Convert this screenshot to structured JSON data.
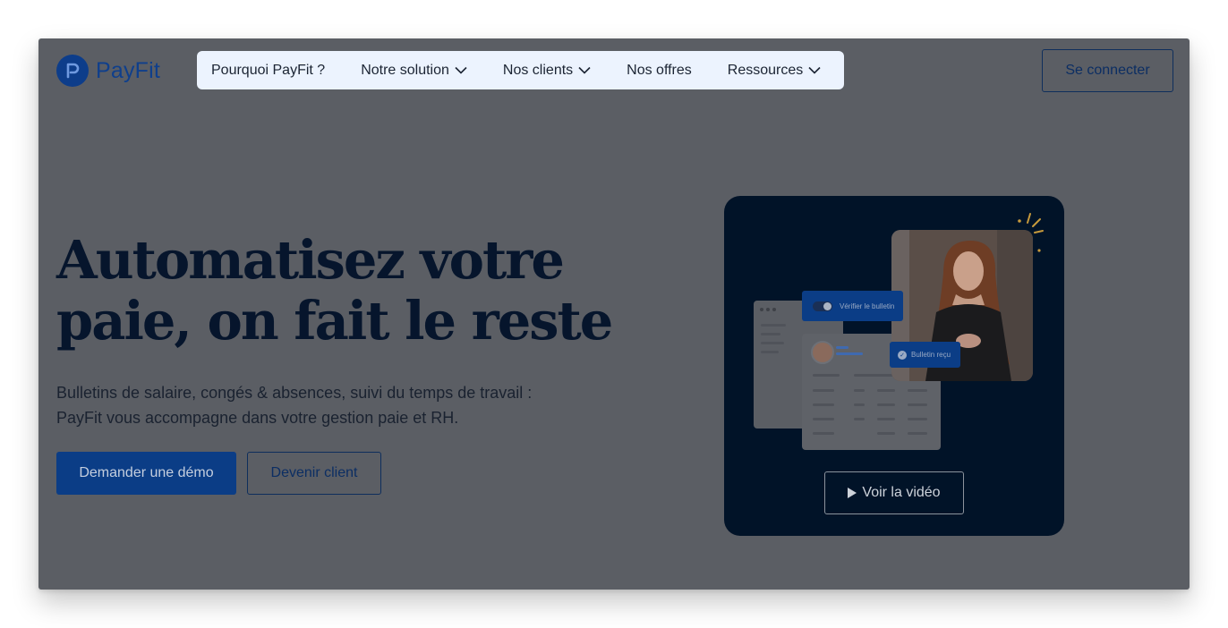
{
  "brand": {
    "name": "PayFit",
    "accent": "#0b3d86"
  },
  "nav": {
    "items": [
      {
        "label": "Pourquoi PayFit ?",
        "has_dropdown": false
      },
      {
        "label": "Notre solution",
        "has_dropdown": true
      },
      {
        "label": "Nos clients",
        "has_dropdown": true
      },
      {
        "label": "Nos offres",
        "has_dropdown": false
      },
      {
        "label": "Ressources",
        "has_dropdown": true
      }
    ],
    "login_label": "Se connecter"
  },
  "hero": {
    "title_line1": "Automatisez votre",
    "title_line2": "paie, on fait le reste",
    "subtitle_line1": "Bulletins de salaire, congés & absences, suivi du temps de travail :",
    "subtitle_line2": "PayFit vous accompagne dans votre gestion paie et RH.",
    "primary_cta": "Demander une démo",
    "secondary_cta": "Devenir client"
  },
  "video_card": {
    "tag_verify": "Vérifier le bulletin",
    "tag_received": "Bulletin reçu",
    "play_label": "Voir la vidéo",
    "play_icon": "play-icon"
  }
}
